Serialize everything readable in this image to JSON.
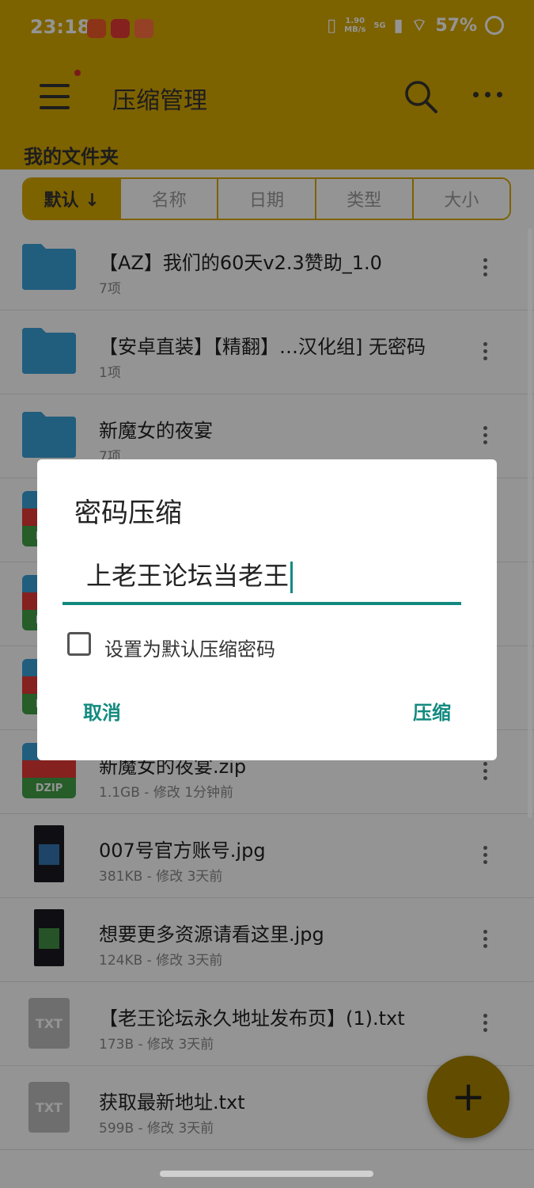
{
  "status_bar": {
    "time": "23:18",
    "app_icons": [
      "app-icon",
      "app-icon",
      "app-icon"
    ],
    "net_speed": "1.90\nMB/s",
    "network": "5G",
    "battery": "57%"
  },
  "toolbar": {
    "title": "压缩管理"
  },
  "section_title": "我的文件夹",
  "sort_tabs": [
    "默认 ↓",
    "名称",
    "日期",
    "类型",
    "大小"
  ],
  "files": [
    {
      "name": "【AZ】我们的60天v2.3赞助_1.0",
      "meta": "7项",
      "icon": "folder-icon"
    },
    {
      "name": "【安卓直装】【精翻】…汉化组] 无密码",
      "meta": "1项",
      "icon": "folder-icon"
    },
    {
      "name": "新魔女的夜宴",
      "meta": "7项",
      "icon": "folder-icon"
    },
    {
      "name": "",
      "meta": "",
      "icon": "zip-icon"
    },
    {
      "name": "",
      "meta": "",
      "icon": "zip-icon"
    },
    {
      "name": "",
      "meta": "",
      "icon": "zip-icon"
    },
    {
      "name": "新魔女的夜宴.zip",
      "meta": "1.1GB - 修改 1分钟前",
      "icon": "zip-icon"
    },
    {
      "name": "007号官方账号.jpg",
      "meta": "381KB - 修改 3天前",
      "icon": "image-thumbnail"
    },
    {
      "name": "想要更多资源请看这里.jpg",
      "meta": "124KB - 修改 3天前",
      "icon": "image-thumbnail"
    },
    {
      "name": "【老王论坛永久地址发布页】(1).txt",
      "meta": "173B - 修改 3天前",
      "icon": "txt-icon"
    },
    {
      "name": "获取最新地址.txt",
      "meta": "599B - 修改 3天前",
      "icon": "txt-icon"
    }
  ],
  "zip_label": "DZIP",
  "txt_label": "TXT",
  "dialog": {
    "title": "密码压缩",
    "input_value": "上老王论坛当老王",
    "checkbox_label": "设置为默认压缩密码",
    "checkbox_checked": false,
    "cancel_label": "取消",
    "confirm_label": "压缩"
  },
  "fab_label": "+",
  "colors": {
    "primary": "#d8a900",
    "accent": "#138a80"
  }
}
